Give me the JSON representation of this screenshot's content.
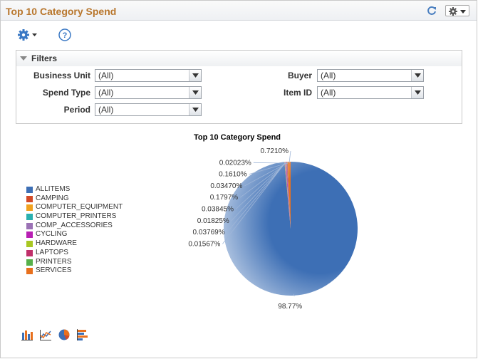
{
  "header": {
    "title": "Top 10 Category Spend"
  },
  "filters": {
    "label": "Filters",
    "fields": [
      {
        "label": "Business Unit",
        "value": "(All)"
      },
      {
        "label": "Spend Type",
        "value": "(All)"
      },
      {
        "label": "Period",
        "value": "(All)"
      },
      {
        "label": "Buyer",
        "value": "(All)"
      },
      {
        "label": "Item ID",
        "value": "(All)"
      }
    ]
  },
  "chart_data": {
    "type": "pie",
    "title": "Top 10 Category Spend",
    "categories": [
      "ALLITEMS",
      "CAMPING",
      "COMPUTER_EQUIPMENT",
      "COMPUTER_PRINTERS",
      "COMP_ACCESSORIES",
      "CYCLING",
      "HARDWARE",
      "LAPTOPS",
      "PRINTERS",
      "SERVICES"
    ],
    "values": [
      98.77,
      0.01567,
      0.03769,
      0.01825,
      0.03845,
      0.1797,
      0.0347,
      0.161,
      0.02023,
      0.721
    ],
    "labels": [
      "98.77%",
      "0.01567%",
      "0.03769%",
      "0.01825%",
      "0.03845%",
      "0.1797%",
      "0.03470%",
      "0.1610%",
      "0.02023%",
      "0.7210%"
    ],
    "colors": [
      "#3d6fb5",
      "#d24a28",
      "#f1a21f",
      "#2ab0b0",
      "#9b72b5",
      "#b81fb3",
      "#a8c722",
      "#c0306a",
      "#56b04a",
      "#e8701d"
    ],
    "legend_position": "left"
  },
  "colors": {
    "title": "#b8762c",
    "accent": "#3d6fb5"
  },
  "icons": {
    "refresh": "refresh-icon",
    "header_menu": "gear-icon",
    "toolbar": "gear-icon",
    "help": "help-icon",
    "chart_types": [
      "bar-chart-icon",
      "line-chart-icon",
      "pie-chart-icon",
      "horizontal-bar-chart-icon"
    ]
  }
}
